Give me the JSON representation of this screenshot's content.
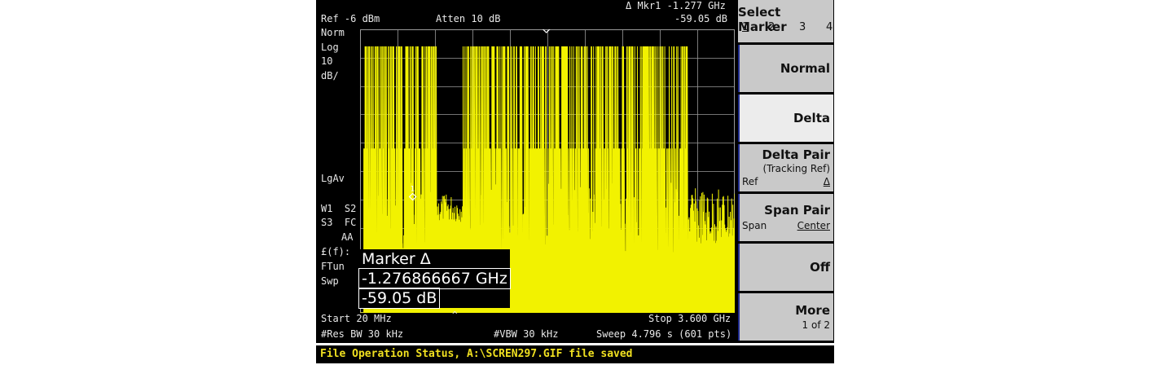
{
  "header": {
    "marker_readout_label": "Δ Mkr1 -1.277 GHz",
    "marker_readout_value": "-59.05 dB",
    "ref_level": "Ref -6 dBm",
    "attenuation": "Atten 10 dB"
  },
  "left_annotations": {
    "norm": "Norm",
    "log": "Log",
    "scale_value": "10",
    "scale_unit": "dB/",
    "averaging": "LgAv",
    "trace_line1": "W1  S2",
    "trace_line2": "S3  FC",
    "coupling": "AA",
    "fun_label": "£(f):",
    "ftun": "FTun",
    "swp": "Swp"
  },
  "markers": {
    "ref_label": "1R",
    "delta_label": "1",
    "ref_level_db": -6,
    "ref_position_ghz": 1.8,
    "delta_position_ghz": 0.523,
    "delta_value_db": -59.05
  },
  "marker_box": {
    "title": "Marker Δ",
    "frequency": "-1.276866667 GHz",
    "amplitude": "-59.05 dB"
  },
  "footer": {
    "start": "Start 20 MHz",
    "stop": "Stop 3.600 GHz",
    "res_bw": "#Res BW 30 kHz",
    "vbw": "#VBW 30 kHz",
    "sweep": "Sweep 4.796 s (601 pts)"
  },
  "softkeys": {
    "select_marker": {
      "label": "Select Marker",
      "options": [
        "1",
        "2",
        "3",
        "4"
      ]
    },
    "normal": "Normal",
    "delta": "Delta",
    "delta_pair": {
      "label": "Delta Pair",
      "sub": "(Tracking Ref)",
      "left": "Ref",
      "right": "Δ"
    },
    "span_pair": {
      "label": "Span Pair",
      "left": "Span",
      "right": "Center"
    },
    "off": "Off",
    "more": {
      "label": "More",
      "sub": "1 of 2"
    }
  },
  "status_bar": "File Operation Status, A:\\SCREN297.GIF file saved",
  "colors": {
    "trace": "#f2f200",
    "grid": "#9a9a9a",
    "softkey_bg": "#c9c9c9",
    "softkey_selected": "#ececec",
    "softkey_border": "#1e2a8c",
    "status_text": "#f0e020"
  },
  "chart_data": {
    "type": "line",
    "x_range_ghz": [
      0.02,
      3.6
    ],
    "y_ref_dbm": -6,
    "y_scale_db_per_div": 10,
    "divisions_x": 10,
    "divisions_y": 10,
    "series": [
      {
        "x": [
          0.02,
          0.05,
          0.8,
          1.0,
          3.0,
          3.15,
          3.6
        ],
        "peak_db": [
          -150,
          -12,
          -12,
          -12,
          -12,
          -150,
          -150
        ],
        "floor_db": [
          -150,
          -48,
          -48,
          -48,
          -48,
          -62,
          -62
        ]
      }
    ]
  }
}
